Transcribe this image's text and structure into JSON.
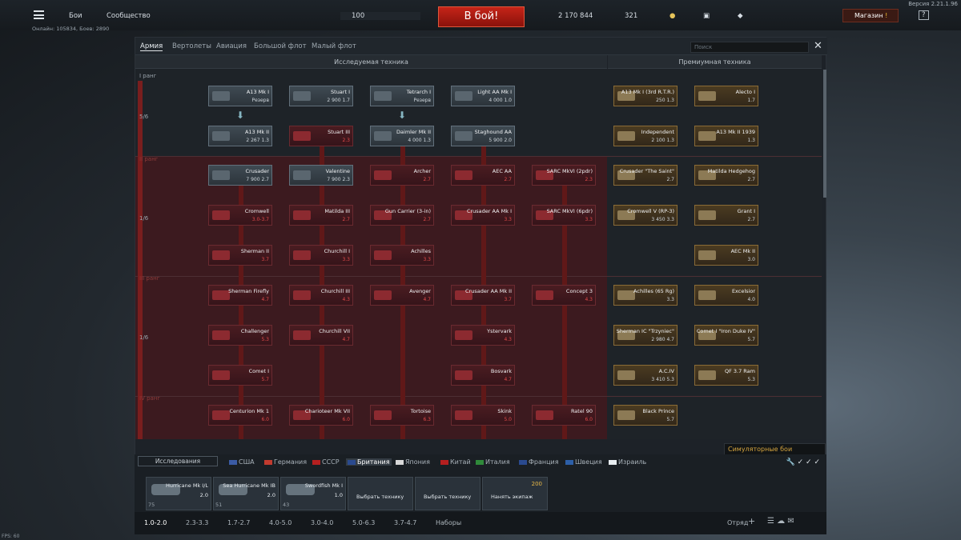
{
  "header": {
    "version": "Версия 2.21.1.96",
    "menu_items": [
      "Бои",
      "Сообщество"
    ],
    "online": "Онлайн: 105834, Боев: 2890",
    "player_level": "100",
    "battle_button": "В бой!",
    "silver_lions": "2 170 844",
    "golden_eagles": "321",
    "shop": "Магазин",
    "shop_badge": "!",
    "help": "?"
  },
  "window": {
    "tabs": [
      "Армия",
      "Вертолеты",
      "Авиация",
      "Большой флот",
      "Малый флот"
    ],
    "search_placeholder": "Поиск",
    "section_research": "Исследуемая техника",
    "section_premium": "Премиумная техника",
    "rank_label": "I ранг",
    "progress": [
      "5/6",
      "1/6",
      "1/6"
    ],
    "rank_markers": [
      "II ранг",
      "III ранг",
      "IV ранг"
    ]
  },
  "cards": [
    {
      "id": "a13-mk1",
      "name": "A13 Mk I",
      "stat": "Резерв"
    },
    {
      "id": "stuart1",
      "name": "Stuart I",
      "stat": "2 900 1.7"
    },
    {
      "id": "tetrarch",
      "name": "Tetrarch I",
      "stat": "Резерв"
    },
    {
      "id": "light-aa",
      "name": "Light AA Mk I",
      "stat": "4 000 1.0"
    },
    {
      "id": "a13-mk2",
      "name": "A13 Mk II",
      "stat": "2 267 1.3"
    },
    {
      "id": "stuart3",
      "name": "Stuart III",
      "stat": "2.3"
    },
    {
      "id": "daimler",
      "name": "Daimler Mk II",
      "stat": "4 000 1.3"
    },
    {
      "id": "staghound",
      "name": "Staghound AA",
      "stat": "5 900 2.0"
    },
    {
      "id": "crusader",
      "name": "Crusader",
      "stat": "7 900 2.7"
    },
    {
      "id": "valentine",
      "name": "Valentine",
      "stat": "7 900 2.3"
    },
    {
      "id": "archer",
      "name": "Archer",
      "stat": "2.7"
    },
    {
      "id": "aec-aa",
      "name": "AEC AA",
      "stat": "2.7"
    },
    {
      "id": "sarc2",
      "name": "SARC MkVI (2pdr)",
      "stat": "2.3"
    },
    {
      "id": "cromwell",
      "name": "Cromwell",
      "stat": "3.0-3.7"
    },
    {
      "id": "matilda3",
      "name": "Matilda III",
      "stat": "2.7"
    },
    {
      "id": "gun-carrier",
      "name": "Gun Carrier (3-in)",
      "stat": "2.7"
    },
    {
      "id": "crusader-aa1",
      "name": "Crusader AA Mk I",
      "stat": "3.3"
    },
    {
      "id": "sarc6",
      "name": "SARC MkVI (6pdr)",
      "stat": "3.3"
    },
    {
      "id": "sherman2",
      "name": "Sherman II",
      "stat": "3.7"
    },
    {
      "id": "churchill1",
      "name": "Churchill I",
      "stat": "3.3"
    },
    {
      "id": "achilles",
      "name": "Achilles",
      "stat": "3.3"
    },
    {
      "id": "firefly",
      "name": "Sherman Firefly",
      "stat": "4.7"
    },
    {
      "id": "churchill3",
      "name": "Churchill III",
      "stat": "4.3"
    },
    {
      "id": "avenger",
      "name": "Avenger",
      "stat": "4.7"
    },
    {
      "id": "crusader-aa2",
      "name": "Crusader AA Mk II",
      "stat": "3.7"
    },
    {
      "id": "concept3",
      "name": "Concept 3",
      "stat": "4.3"
    },
    {
      "id": "challenger",
      "name": "Challenger",
      "stat": "5.3"
    },
    {
      "id": "churchill7",
      "name": "Churchill VII",
      "stat": "4.7"
    },
    {
      "id": "ystervark",
      "name": "Ystervark",
      "stat": "4.3"
    },
    {
      "id": "comet",
      "name": "Comet I",
      "stat": "5.7"
    },
    {
      "id": "bosvark",
      "name": "Bosvark",
      "stat": "4.7"
    },
    {
      "id": "centurion",
      "name": "Centurion Mk 1",
      "stat": "6.0"
    },
    {
      "id": "charioteer",
      "name": "Charioteer Mk VII",
      "stat": "6.0"
    },
    {
      "id": "tortoise",
      "name": "Tortoise",
      "stat": "6.3"
    },
    {
      "id": "skink",
      "name": "Skink",
      "stat": "5.0"
    },
    {
      "id": "ratel",
      "name": "Ratel 90",
      "stat": "6.0"
    },
    {
      "id": "a13-rtr",
      "name": "A13 Mk I (3rd R.T.R.)",
      "stat": "250 1.3"
    },
    {
      "id": "alecto",
      "name": "Alecto I",
      "stat": "1.7"
    },
    {
      "id": "independent",
      "name": "Independent",
      "stat": "2 100 1.3"
    },
    {
      "id": "a13-1939",
      "name": "A13 Mk II 1939",
      "stat": "1.3"
    },
    {
      "id": "saint",
      "name": "Crusader \"The Saint\"",
      "stat": "2.7"
    },
    {
      "id": "hedgehog",
      "name": "Matilda Hedgehog",
      "stat": "2.7"
    },
    {
      "id": "cromwell5",
      "name": "Cromwell V (RP-3)",
      "stat": "3 450 3.3"
    },
    {
      "id": "grant1",
      "name": "Grant I",
      "stat": "2.7"
    },
    {
      "id": "aec2",
      "name": "AEC Mk II",
      "stat": "3.0"
    },
    {
      "id": "achilles65",
      "name": "Achilles (65 Rg)",
      "stat": "3.3"
    },
    {
      "id": "excelsior",
      "name": "Excelsior",
      "stat": "4.0"
    },
    {
      "id": "trzyniec",
      "name": "Sherman IC \"Trzyniec\"",
      "stat": "2 980 4.7"
    },
    {
      "id": "iron-duke",
      "name": "Comet I \"Iron Duke IV\"",
      "stat": "5.7"
    },
    {
      "id": "aciv",
      "name": "A.C.IV",
      "stat": "3 410 5.3"
    },
    {
      "id": "qf-ram",
      "name": "QF 3.7 Ram",
      "stat": "5.3"
    },
    {
      "id": "black-prince",
      "name": "Black Prince",
      "stat": "5.7"
    }
  ],
  "game_mode": "Симуляторные бои",
  "bottom": {
    "explore": "Исследования",
    "nations": [
      "США",
      "Германия",
      "СССР",
      "Британия",
      "Япония",
      "Китай",
      "Италия",
      "Франция",
      "Швеция",
      "Израиль"
    ],
    "crew": [
      {
        "name": "Hurricane Mk I/L",
        "stat": "2.0",
        "bottom": "75"
      },
      {
        "name": "Sea Hurricane Mk IB",
        "stat": "2.0",
        "bottom": "51"
      },
      {
        "name": "Swordfish Mk I",
        "stat": "1.0",
        "bottom": "43"
      }
    ],
    "actions": [
      "Выбрать технику",
      "Выбрать технику",
      "Нанять экипаж"
    ],
    "hire_cost": "200"
  },
  "tiers": [
    "1.0-2.0",
    "2.3-3.3",
    "1.7-2.7",
    "4.0-5.0",
    "3.0-4.0",
    "5.0-6.3",
    "3.7-4.7",
    "Наборы"
  ],
  "squad": "Отряд",
  "fps": "FPS: 60"
}
